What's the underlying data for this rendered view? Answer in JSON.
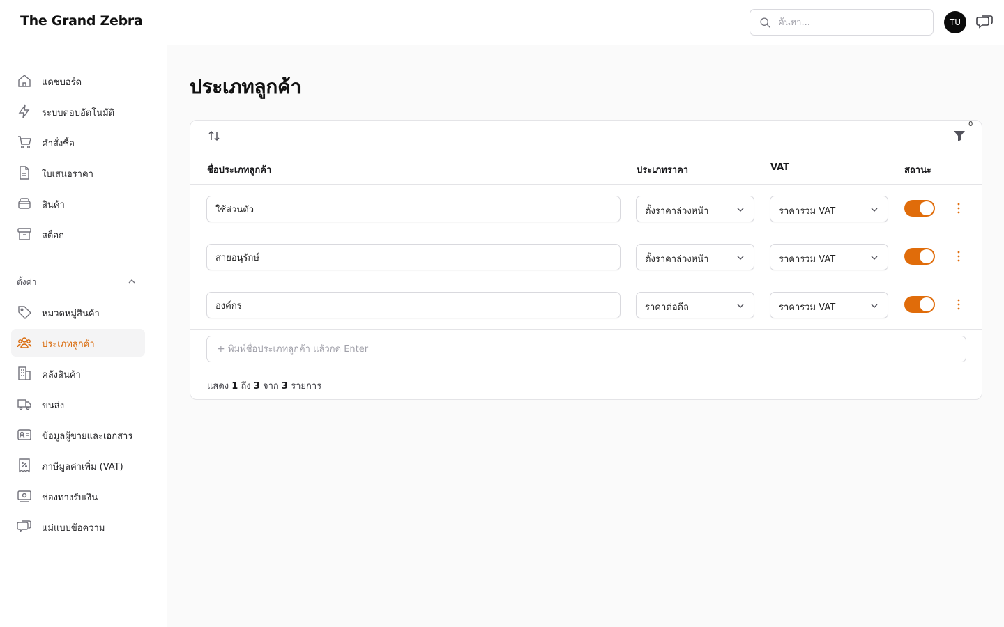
{
  "app": {
    "brand": "The Grand Zebra"
  },
  "header": {
    "search_placeholder": "ค้นหา...",
    "avatar_initials": "TU"
  },
  "sidebar": {
    "items": [
      {
        "label": "แดชบอร์ด",
        "icon": "home-icon"
      },
      {
        "label": "ระบบตอบอัตโนมัติ",
        "icon": "lightning-icon"
      },
      {
        "label": "คำสั่งซื้อ",
        "icon": "cart-icon"
      },
      {
        "label": "ใบเสนอราคา",
        "icon": "document-icon"
      },
      {
        "label": "สินค้า",
        "icon": "box-icon"
      },
      {
        "label": "สต็อก",
        "icon": "archive-icon"
      }
    ],
    "settings_label": "ตั้งค่า",
    "settings_items": [
      {
        "label": "หมวดหมู่สินค้า",
        "icon": "tag-icon"
      },
      {
        "label": "ประเภทลูกค้า",
        "icon": "users-icon",
        "active": true
      },
      {
        "label": "คลังสินค้า",
        "icon": "building-icon"
      },
      {
        "label": "ขนส่ง",
        "icon": "truck-icon"
      },
      {
        "label": "ข้อมูลผู้ขายและเอกสาร",
        "icon": "id-card-icon"
      },
      {
        "label": "ภาษีมูลค่าเพิ่ม (VAT)",
        "icon": "receipt-percent-icon"
      },
      {
        "label": "ช่องทางรับเงิน",
        "icon": "money-icon"
      },
      {
        "label": "แม่แบบข้อความ",
        "icon": "chat-icon"
      }
    ]
  },
  "main": {
    "title": "ประเภทลูกค้า",
    "filter_count": "0",
    "columns": {
      "name": "ชื่อประเภทลูกค้า",
      "price_type": "ประเภทราคา",
      "vat": "VAT",
      "status": "สถานะ"
    },
    "rows": [
      {
        "name": "ใช้ส่วนตัว",
        "price_type": "ตั้งราคาล่วงหน้า",
        "vat": "ราคารวม VAT",
        "enabled": true
      },
      {
        "name": "สายอนุรักษ์",
        "price_type": "ตั้งราคาล่วงหน้า",
        "vat": "ราคารวม VAT",
        "enabled": true
      },
      {
        "name": "องค์กร",
        "price_type": "ราคาต่อดีล",
        "vat": "ราคารวม VAT",
        "enabled": true
      }
    ],
    "add_placeholder": "พิมพ์ชื่อประเภทลูกค้า แล้วกด Enter",
    "add_plus": "+",
    "footer": {
      "prefix": "แสดง",
      "from": "1",
      "to_word": "ถึง",
      "to": "3",
      "of_word": "จาก",
      "total": "3",
      "suffix": "รายการ"
    },
    "accent_color": "#e06c0a"
  }
}
